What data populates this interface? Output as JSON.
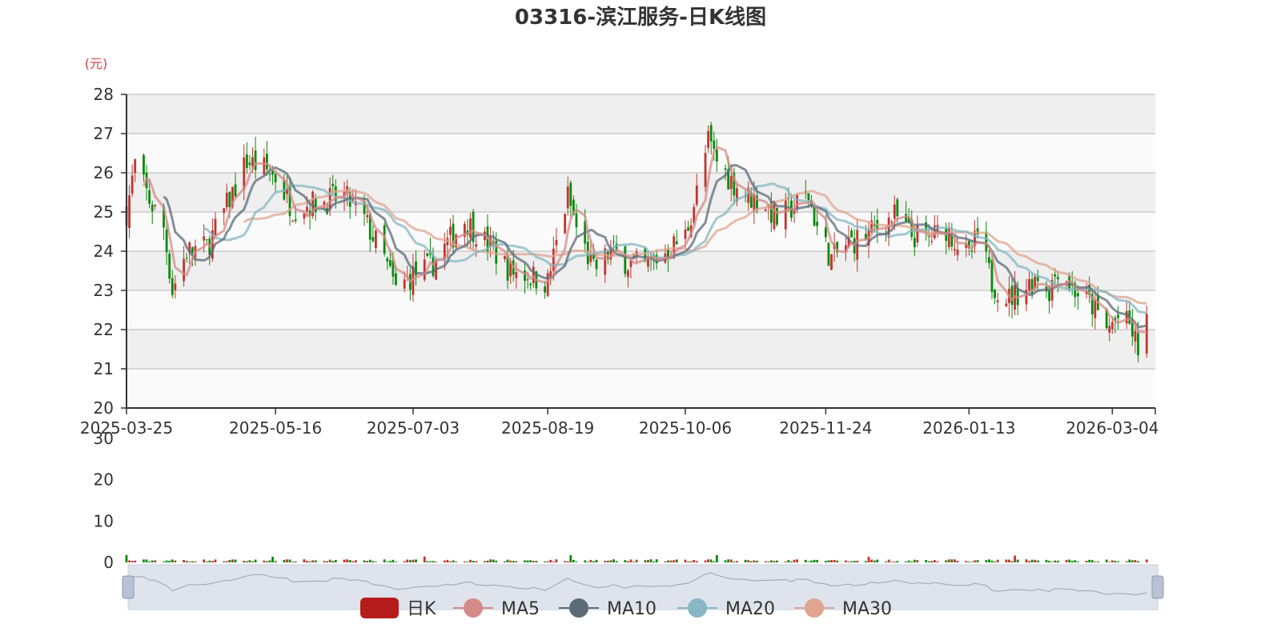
{
  "chart_data": {
    "type": "candlestick",
    "title": "03316-滨江服务-日K线图",
    "y_unit": "(元)",
    "price_axis": {
      "ylim": [
        20,
        28
      ],
      "ticks": [
        "28",
        "27",
        "26",
        "25",
        "24",
        "23",
        "22",
        "21",
        "20"
      ]
    },
    "volume_axis": {
      "ylim": [
        0,
        30
      ],
      "ticks": [
        "30",
        "20",
        "10",
        "0"
      ]
    },
    "x_ticks": [
      "2025-03-25",
      "2025-05-16",
      "2025-07-03",
      "2025-08-19",
      "2025-10-06",
      "2025-11-24",
      "2026-01-13",
      "2026-03-04"
    ],
    "legend": [
      "日K",
      "MA5",
      "MA10",
      "MA20",
      "MA30"
    ],
    "colors": {
      "up": "#c23531",
      "down": "#0a8a0a",
      "MA5": "#d48b88",
      "MA10": "#5b6b78",
      "MA20": "#86b7c2",
      "MA30": "#e0a590",
      "grid_band": "#efefef",
      "zoom_fill": "#dfe3ec"
    },
    "series_path": [
      [
        "2025-03-25",
        25.0
      ],
      [
        "2025-03-28",
        26.2
      ],
      [
        "2025-04-02",
        25.3
      ],
      [
        "2025-04-07",
        24.6
      ],
      [
        "2025-04-10",
        23.0
      ],
      [
        "2025-04-15",
        24.0
      ],
      [
        "2025-04-22",
        24.1
      ],
      [
        "2025-04-28",
        25.0
      ],
      [
        "2025-05-06",
        26.3
      ],
      [
        "2025-05-12",
        26.1
      ],
      [
        "2025-05-16",
        25.9
      ],
      [
        "2025-05-22",
        25.1
      ],
      [
        "2025-05-28",
        25.2
      ],
      [
        "2025-06-03",
        25.3
      ],
      [
        "2025-06-09",
        25.4
      ],
      [
        "2025-06-16",
        24.8
      ],
      [
        "2025-06-23",
        23.8
      ],
      [
        "2025-06-27",
        23.0
      ],
      [
        "2025-07-03",
        23.4
      ],
      [
        "2025-07-09",
        23.6
      ],
      [
        "2025-07-15",
        24.2
      ],
      [
        "2025-07-21",
        24.8
      ],
      [
        "2025-07-25",
        24.5
      ],
      [
        "2025-07-31",
        24.0
      ],
      [
        "2025-08-06",
        23.5
      ],
      [
        "2025-08-12",
        23.4
      ],
      [
        "2025-08-19",
        23.2
      ],
      [
        "2025-08-22",
        24.2
      ],
      [
        "2025-08-26",
        25.4
      ],
      [
        "2025-08-29",
        24.6
      ],
      [
        "2025-09-04",
        23.5
      ],
      [
        "2025-09-10",
        24.0
      ],
      [
        "2025-09-16",
        23.7
      ],
      [
        "2025-09-22",
        23.6
      ],
      [
        "2025-09-26",
        23.8
      ],
      [
        "2025-10-06",
        24.4
      ],
      [
        "2025-10-10",
        25.5
      ],
      [
        "2025-10-14",
        26.8
      ],
      [
        "2025-10-17",
        26.3
      ],
      [
        "2025-10-22",
        25.8
      ],
      [
        "2025-10-28",
        25.4
      ],
      [
        "2025-11-03",
        25.2
      ],
      [
        "2025-11-07",
        24.8
      ],
      [
        "2025-11-12",
        25.1
      ],
      [
        "2025-11-18",
        25.4
      ],
      [
        "2025-11-21",
        24.6
      ],
      [
        "2025-11-26",
        23.8
      ],
      [
        "2025-12-02",
        24.2
      ],
      [
        "2025-12-08",
        24.4
      ],
      [
        "2025-12-12",
        24.6
      ],
      [
        "2025-12-18",
        24.9
      ],
      [
        "2025-12-24",
        24.4
      ],
      [
        "2025-12-30",
        24.3
      ],
      [
        "2026-01-05",
        24.6
      ],
      [
        "2026-01-09",
        24.2
      ],
      [
        "2026-01-13",
        23.8
      ],
      [
        "2026-01-16",
        24.4
      ],
      [
        "2026-01-21",
        23.2
      ],
      [
        "2026-01-27",
        22.8
      ],
      [
        "2026-02-02",
        23.1
      ],
      [
        "2026-02-06",
        23.4
      ],
      [
        "2026-02-10",
        23.0
      ],
      [
        "2026-02-13",
        23.6
      ],
      [
        "2026-02-19",
        23.0
      ],
      [
        "2026-02-25",
        22.6
      ],
      [
        "2026-03-02",
        22.0
      ],
      [
        "2026-03-06",
        22.3
      ],
      [
        "2026-03-10",
        22.1
      ],
      [
        "2026-03-13",
        21.5
      ],
      [
        "2026-03-16",
        22.3
      ]
    ],
    "ma_offsets": {
      "MA5": [
        0.0,
        0.5
      ],
      "MA10": [
        0.15,
        1.0
      ],
      "MA20": [
        0.3,
        1.6
      ],
      "MA30": [
        0.45,
        2.2
      ]
    }
  }
}
